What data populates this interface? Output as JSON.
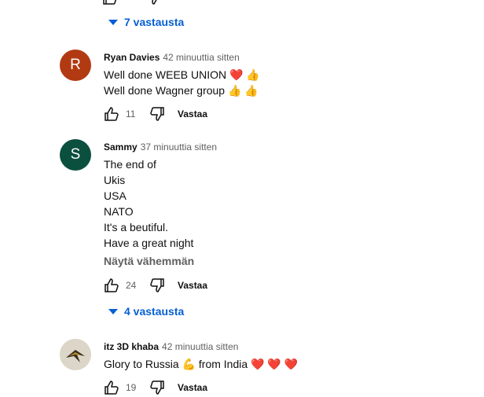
{
  "replies_toggle_1": "7 vastausta",
  "comments": [
    {
      "author": "Ryan Davies",
      "time": "42 minuuttia sitten",
      "avatar_letter": "R",
      "avatar_color": "#b23a12",
      "lines": [
        "Well done WEEB UNION ❤️ 👍",
        "Well done Wagner group 👍 👍"
      ],
      "likes": "11",
      "reply_label": "Vastaa"
    },
    {
      "author": "Sammy",
      "time": "37 minuuttia sitten",
      "avatar_letter": "S",
      "avatar_color": "#0b4f3f",
      "lines": [
        "The end of",
        "Ukis",
        "USA",
        "NATO",
        "It's a beutiful.",
        "Have a great night"
      ],
      "show_less": "Näytä vähemmän",
      "likes": "24",
      "reply_label": "Vastaa",
      "replies_toggle": "4 vastausta"
    },
    {
      "author": "itz 3D khaba",
      "time": "42 minuuttia sitten",
      "lines": [
        "Glory to Russia 💪 from India ❤️ ❤️ ❤️"
      ],
      "likes": "19",
      "reply_label": "Vastaa"
    }
  ],
  "colors": {
    "link": "#065fd4",
    "secondary_text": "#606060"
  }
}
